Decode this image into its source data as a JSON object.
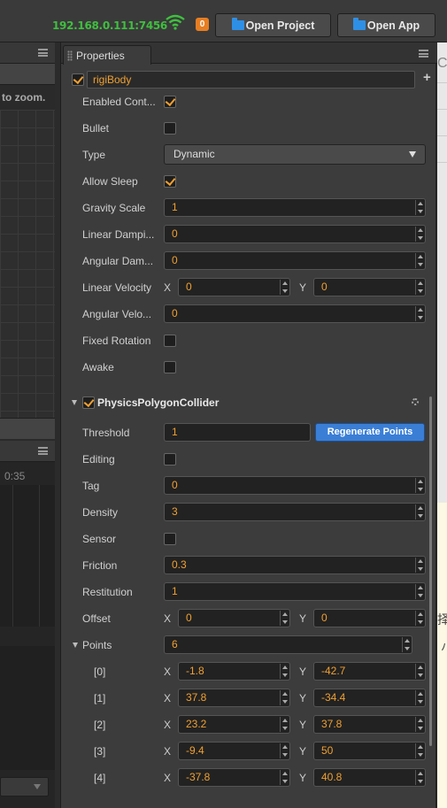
{
  "toolbar": {
    "ip_address": "192.168.0.111:7456",
    "badge_count": "0",
    "open_project_label": "Open Project",
    "open_app_label": "Open App"
  },
  "scene_panel": {
    "hint_text": "to zoom."
  },
  "timeline_panel": {
    "timecode": "0:35"
  },
  "properties": {
    "tab_label": "Properties",
    "node_name": "rigiBody",
    "node_enabled": true,
    "rigidbody": {
      "enabled_contact": {
        "label": "Enabled Cont...",
        "checked": true
      },
      "bullet": {
        "label": "Bullet",
        "checked": false
      },
      "type": {
        "label": "Type",
        "value": "Dynamic"
      },
      "allow_sleep": {
        "label": "Allow Sleep",
        "checked": true
      },
      "gravity_scale": {
        "label": "Gravity Scale",
        "value": "1"
      },
      "linear_damping": {
        "label": "Linear Dampi...",
        "value": "0"
      },
      "angular_damping": {
        "label": "Angular Dam...",
        "value": "0"
      },
      "linear_velocity": {
        "label": "Linear Velocity",
        "x_label": "X",
        "x": "0",
        "y_label": "Y",
        "y": "0"
      },
      "angular_velocity": {
        "label": "Angular Velo...",
        "value": "0"
      },
      "fixed_rotation": {
        "label": "Fixed Rotation",
        "checked": false
      },
      "awake": {
        "label": "Awake",
        "checked": false
      }
    },
    "collider": {
      "title": "PhysicsPolygonCollider",
      "enabled": true,
      "threshold": {
        "label": "Threshold",
        "value": "1"
      },
      "regenerate_label": "Regenerate Points",
      "editing": {
        "label": "Editing",
        "checked": false
      },
      "tag": {
        "label": "Tag",
        "value": "0"
      },
      "density": {
        "label": "Density",
        "value": "3"
      },
      "sensor": {
        "label": "Sensor",
        "checked": false
      },
      "friction": {
        "label": "Friction",
        "value": "0.3"
      },
      "restitution": {
        "label": "Restitution",
        "value": "1"
      },
      "offset": {
        "label": "Offset",
        "x_label": "X",
        "x": "0",
        "y_label": "Y",
        "y": "0"
      },
      "points": {
        "label": "Points",
        "count": "6",
        "items": [
          {
            "index": "[0]",
            "x": "-1.8",
            "y": "-42.7"
          },
          {
            "index": "[1]",
            "x": "37.8",
            "y": "-34.4"
          },
          {
            "index": "[2]",
            "x": "23.2",
            "y": "37.8"
          },
          {
            "index": "[3]",
            "x": "-9.4",
            "y": "50"
          },
          {
            "index": "[4]",
            "x": "-37.8",
            "y": "40.8"
          }
        ]
      }
    }
  },
  "right_strip": {
    "glyph_c": "C",
    "cjk_char": "择",
    "cjk_mark": "ハ"
  },
  "colors": {
    "accent": "#f0a030",
    "ip_green": "#3fbf3f",
    "button_blue": "#3a7ed6",
    "panel_bg": "#3c3c3c"
  }
}
